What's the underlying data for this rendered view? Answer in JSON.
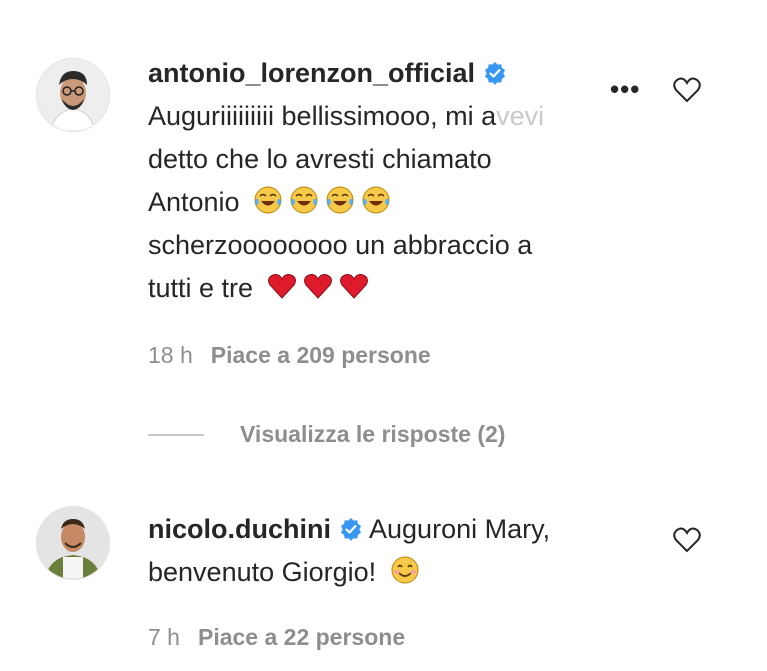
{
  "comments": [
    {
      "username": "antonio_lorenzon_official",
      "text_line1_start": "Auguriiiiiiiii bellissimooo, mi a",
      "text_line1_fade": "vevi",
      "text_line2": "detto che lo avresti chiamato",
      "text_line3": "Antonio",
      "text_line4": "scherzoooooooo un abbraccio a",
      "text_line5": "tutti e tre",
      "time": "18 h",
      "likes": "Piace a 209 persone"
    },
    {
      "username": "nicolo.duchini",
      "text_inline": "Auguroni Mary,",
      "text_line2": "benvenuto Giorgio!",
      "time": "7 h",
      "likes": "Piace a 22 persone"
    }
  ],
  "replies": {
    "label": "Visualizza le risposte (2)"
  },
  "colors": {
    "text": "#262626",
    "muted": "#8e8e8e",
    "verified": "#3897f0",
    "heart": "#e0245e"
  },
  "icons": [
    "verified-badge-icon",
    "more-options-icon",
    "heart-outline-icon",
    "tears-of-joy-emoji-icon",
    "red-heart-emoji-icon",
    "smiling-emoji-icon"
  ]
}
